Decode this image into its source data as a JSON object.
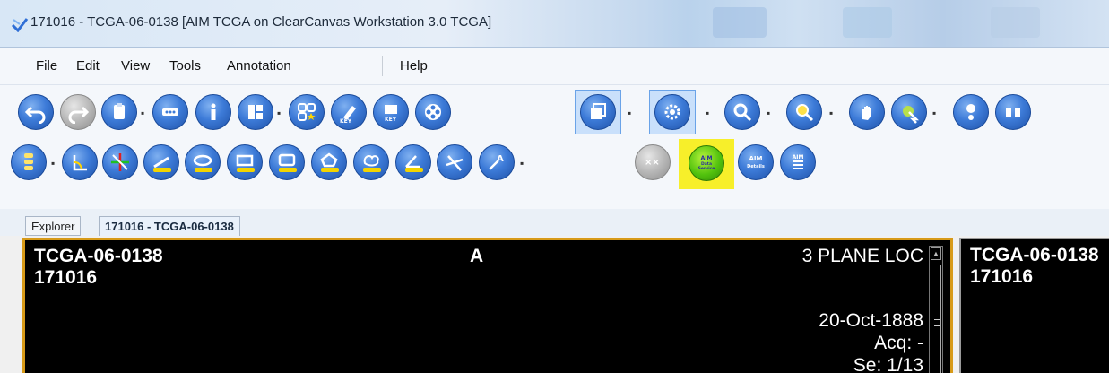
{
  "window": {
    "title": "171016 - TCGA-06-0138 [AIM TCGA on ClearCanvas Workstation 3.0 TCGA]"
  },
  "menu": [
    "File",
    "Edit",
    "View",
    "Tools",
    "Annotation",
    "Help"
  ],
  "toolbar_row1": [
    {
      "name": "undo-icon"
    },
    {
      "name": "redo-icon"
    },
    {
      "name": "clipboard-icon"
    },
    {
      "name": "more-icon"
    },
    {
      "name": "info-icon"
    },
    {
      "name": "layout-icon"
    },
    {
      "name": "key-image-icon"
    },
    {
      "name": "key-edit-icon"
    },
    {
      "name": "key-image-series-icon"
    },
    {
      "name": "cine-icon"
    },
    {
      "name": "stack-icon"
    },
    {
      "name": "settings-icon"
    },
    {
      "name": "zoom-icon"
    },
    {
      "name": "magnify-icon"
    },
    {
      "name": "pan-icon"
    },
    {
      "name": "probe-icon"
    },
    {
      "name": "pixel-info-icon"
    },
    {
      "name": "flip-icon"
    }
  ],
  "toolbar_row2": [
    {
      "name": "spine-icon"
    },
    {
      "name": "angle-tool-icon"
    },
    {
      "name": "reference-lines-icon"
    },
    {
      "name": "ruler-icon"
    },
    {
      "name": "ellipse-roi-icon"
    },
    {
      "name": "rectangle-roi-icon"
    },
    {
      "name": "polygon-roi-icon"
    },
    {
      "name": "freehand-roi-icon"
    },
    {
      "name": "protractor-icon"
    },
    {
      "name": "cobb-angle-icon"
    },
    {
      "name": "text-callout-icon"
    },
    {
      "name": "delete-annotations-icon"
    },
    {
      "name": "aim-data-service-icon",
      "label": "AIM Data Service"
    },
    {
      "name": "aim-details-icon",
      "label": "AIM Details"
    },
    {
      "name": "aim-report-icon",
      "label": "AIM"
    }
  ],
  "tabs": [
    {
      "label": "Explorer"
    },
    {
      "label": "171016 - TCGA-06-0138"
    }
  ],
  "pane1": {
    "patient_id": "TCGA-06-0138",
    "study_id": "171016",
    "orientation": "A",
    "series_desc": "3 PLANE LOC",
    "date": "20-Oct-1888",
    "acq": "Acq: -",
    "series": "Se: 1/13"
  },
  "pane2": {
    "patient_id": "TCGA-06-0138",
    "study_id": "171016"
  },
  "colors": {
    "active_frame": "#d79a18",
    "highlight": "#f7ef2a",
    "toolbar_blue": "#3d7bd8"
  }
}
